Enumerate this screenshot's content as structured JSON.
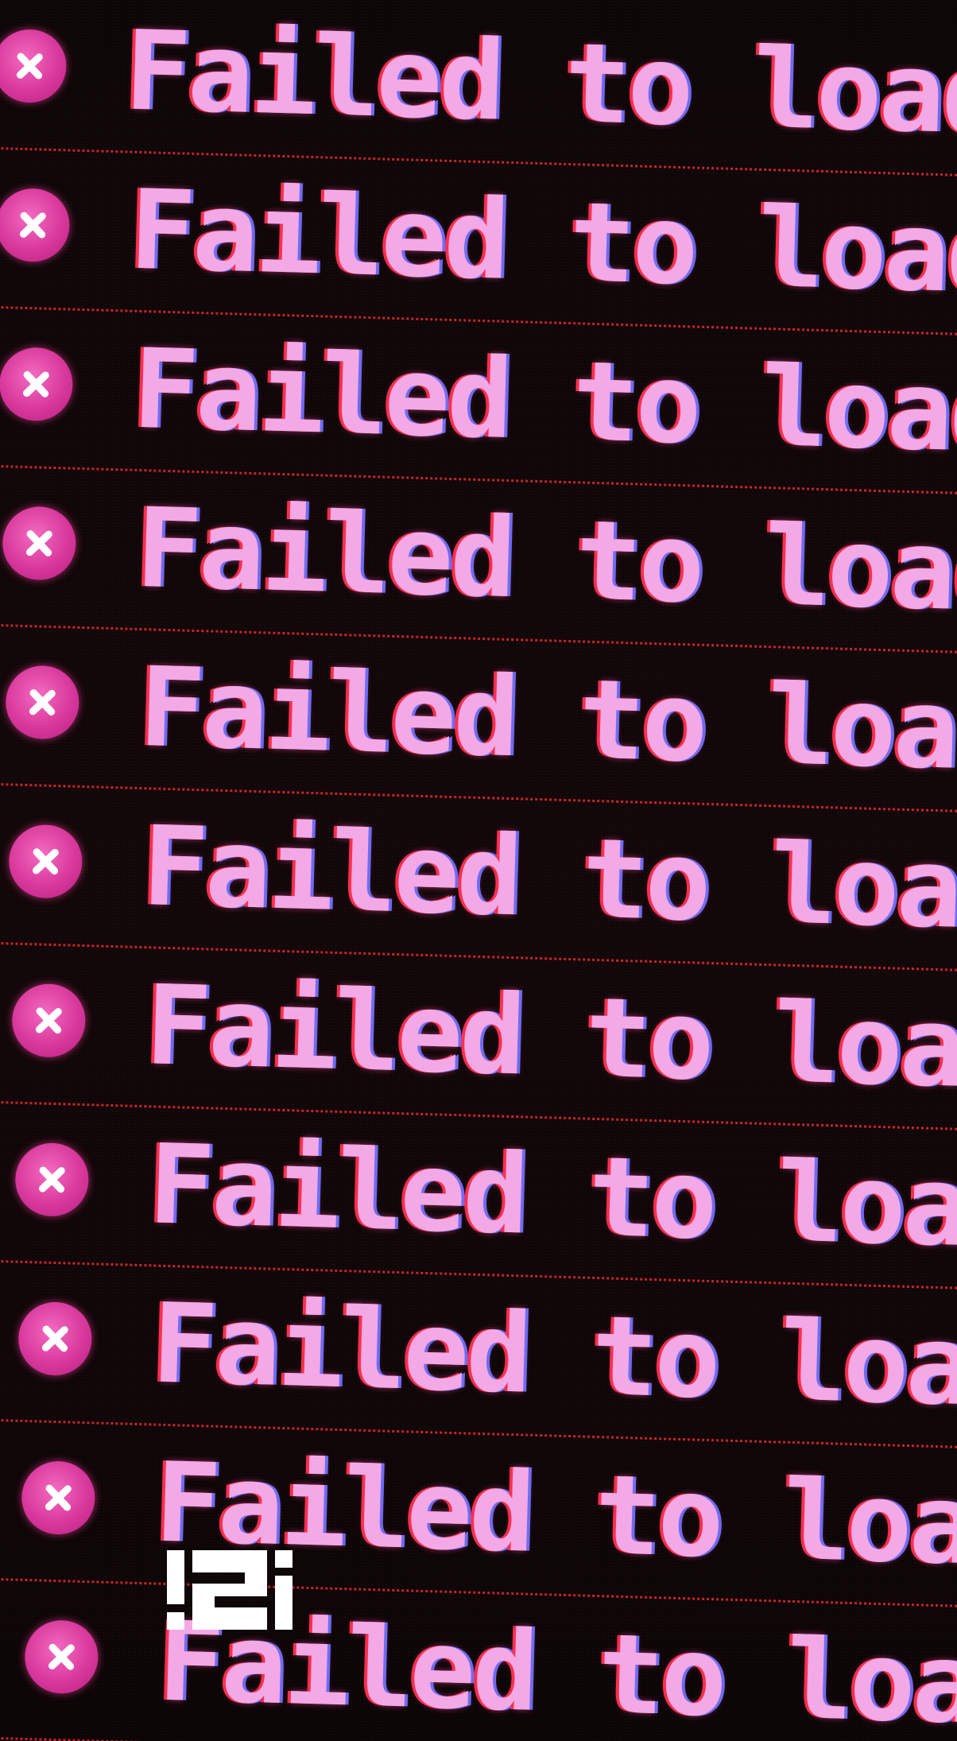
{
  "log": {
    "lines": [
      {
        "text": "Failed to load r",
        "icon": "error-x-icon"
      },
      {
        "text": "Failed to load r",
        "icon": "error-x-icon"
      },
      {
        "text": "Failed to load r",
        "icon": "error-x-icon"
      },
      {
        "text": "Failed to load r",
        "icon": "error-x-icon"
      },
      {
        "text": "Failed to load r",
        "icon": "error-x-icon"
      },
      {
        "text": "Failed to load r",
        "icon": "error-x-icon"
      },
      {
        "text": "Failed to load r",
        "icon": "error-x-icon"
      },
      {
        "text": "Failed to load r",
        "icon": "error-x-icon"
      },
      {
        "text": "Failed to load r",
        "icon": "error-x-icon"
      },
      {
        "text": "Failed to load r",
        "icon": "error-x-icon"
      },
      {
        "text": "Failed to load r",
        "icon": "error-x-icon"
      }
    ]
  },
  "logo": {
    "text": "!2!",
    "icon": "brand-logo"
  },
  "colors": {
    "background": "#0d0607",
    "text": "#f2a9e6",
    "icon": "#d8389b",
    "divider": "#e0262f",
    "logo": "#ffffff"
  }
}
